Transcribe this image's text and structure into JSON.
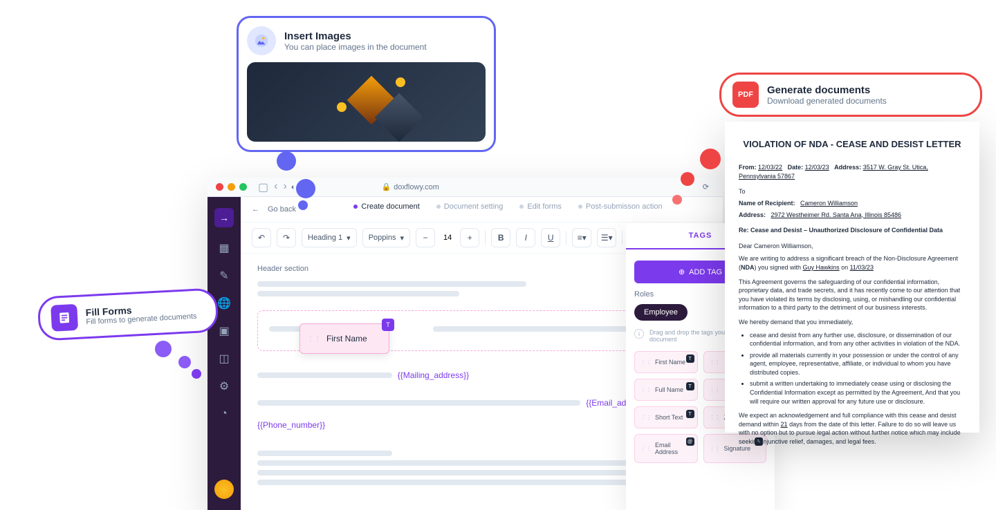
{
  "insert": {
    "title": "Insert Images",
    "subtitle": "You can place images in the document"
  },
  "fill": {
    "title": "Fill Forms",
    "subtitle": "Fill forms to generate documents"
  },
  "generate": {
    "title": "Generate documents",
    "subtitle": "Download generated documents",
    "icon_label": "PDF"
  },
  "browser": {
    "url": "doxflowy.com"
  },
  "app": {
    "go_back": "Go back",
    "tabs": [
      {
        "label": "Create document",
        "active": true
      },
      {
        "label": "Document setting",
        "active": false
      },
      {
        "label": "Edit forms",
        "active": false
      },
      {
        "label": "Post-submisson action",
        "active": false
      }
    ],
    "toolbar": {
      "heading": "Heading 1",
      "font": "Poppins",
      "size": "14"
    },
    "canvas": {
      "header_section": "Header section",
      "drag_tag": "First Name",
      "vars": {
        "mailing": "{{Mailing_address}}",
        "email": "{{Email_address}}",
        "phone": "{{Phone_number}}"
      }
    }
  },
  "tags_panel": {
    "header": "TAGS",
    "add_btn": "ADD TAG",
    "roles_label": "Roles",
    "role": "Employee",
    "hint": "Drag and drop the tags you'd like document",
    "tags": [
      {
        "label": "First Name",
        "icon": "T"
      },
      {
        "label": "",
        "icon": ""
      },
      {
        "label": "Full Name",
        "icon": "T"
      },
      {
        "label": "",
        "icon": ""
      },
      {
        "label": "Short Text",
        "icon": "T"
      },
      {
        "label": "Zip Code",
        "icon": ""
      },
      {
        "label": "Email Address",
        "icon": "@"
      },
      {
        "label": "Signature",
        "icon": "✎"
      }
    ]
  },
  "doc": {
    "title": "VIOLATION OF NDA - CEASE AND DESIST LETTER",
    "from_label": "From:",
    "from_date1": "12/03/22",
    "date_label": "Date:",
    "from_date2": "12/03/23",
    "addr_label": "Address:",
    "from_addr": "3517 W. Gray St. Utica, Pennsylvania 57867",
    "to": "To",
    "recipient_label": "Name of Recipient:",
    "recipient": "Cameron Williamson",
    "to_addr": "2972 Westheimer Rd. Santa Ana, Illinois 85486",
    "re": "Re: Cease and Desist – Unauthorized Disclosure of Confidential Data",
    "dear": "Dear Cameron Williamson,",
    "p1a": "We are writing to address a significant breach of the Non-Disclosure Agreement (",
    "nda": "NDA",
    "p1b": ") you signed with ",
    "signer": "Guy Hawkins",
    "p1c": " on ",
    "sign_date": "11/03/23",
    "p2": "This Agreement governs the safeguarding of our confidential information, proprietary data, and trade secrets, and it has recently come to our attention that you have violated its terms by disclosing, using, or mishandling our confidential information to a third party to the detriment of our business interests.",
    "demand": "We hereby demand that you immediately,",
    "li1": "cease and desist from any further use, disclosure, or dissemination of our confidential information, and from any other activities in violation of the NDA.",
    "li2": "provide all materials currently in your possession or under the control of any agent, employee, representative, affiliate, or individual to whom you have distributed copies.",
    "li3": "submit a written undertaking to immediately cease using or disclosing the Confidential Information except as permitted by the Agreement, And that you will require our written approval for any future use or disclosure.",
    "p3a": "We expect an acknowledgement and full compliance with this cease and desist demand within ",
    "days": "21",
    "p3b": " days from the date of this letter. Failure to do so will leave us with no option but to pursue legal action without further notice which may include seeking injunctive relief, damages, and legal fees."
  }
}
